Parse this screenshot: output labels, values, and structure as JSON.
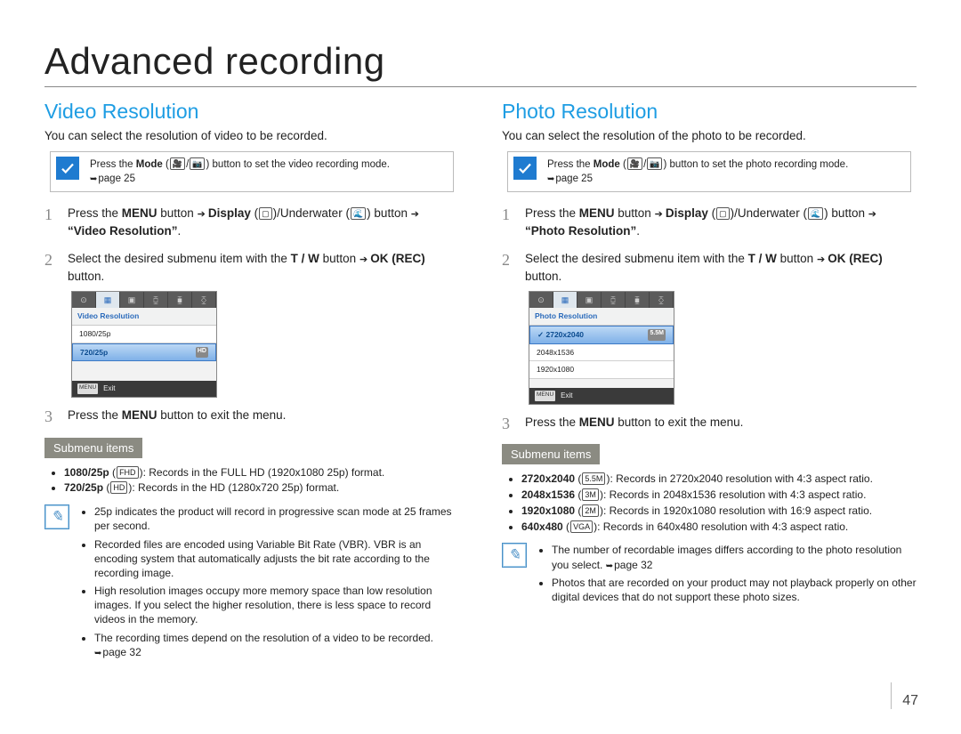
{
  "page": {
    "title": "Advanced recording",
    "number": "47"
  },
  "left": {
    "heading": "Video Resolution",
    "intro": "You can select the resolution of video to be recorded.",
    "tip_prefix": "Press the ",
    "tip_mode": "Mode",
    "tip_suffix": " button to set the video recording mode.",
    "tip_pageref": "page 25",
    "step1_a": "Press the ",
    "step1_menu": "MENU",
    "step1_b": " button ",
    "step1_display": "Display",
    "step1_under": "/Underwater",
    "step1_c": " button ",
    "step1_target": "“Video Resolution”",
    "step2_a": "Select the desired submenu item with the ",
    "step2_tw": "T / W",
    "step2_b": " button ",
    "step2_ok": "OK (REC)",
    "step2_c": " button.",
    "lcd_header": "Video Resolution",
    "lcd_rows": [
      {
        "label": "1080/25p",
        "sel": false
      },
      {
        "label": "720/25p",
        "sel": true,
        "badge": "HD"
      }
    ],
    "lcd_exit": "Exit",
    "step3_a": "Press the ",
    "step3_menu": "MENU",
    "step3_b": " button to exit the menu.",
    "submenu_label": "Submenu items",
    "submenu": [
      {
        "name": "1080/25p",
        "desc": ": Records in the FULL HD (1920x1080 25p) format."
      },
      {
        "name": "720/25p",
        "desc": ": Records in the HD (1280x720 25p) format."
      }
    ],
    "notes": [
      "25p indicates the product will record in progressive scan mode at 25 frames per second.",
      "Recorded files are encoded using Variable Bit Rate (VBR). VBR is an encoding system that automatically adjusts the bit rate according to the recording image.",
      "High resolution images occupy more memory space than low resolution images. If you select the higher resolution, there is less space to record videos in the memory.",
      "The recording times depend on the resolution of a video to be recorded. "
    ],
    "notes_pageref": "page 32"
  },
  "right": {
    "heading": "Photo Resolution",
    "intro": "You can select the resolution of the photo to be recorded.",
    "tip_prefix": "Press the ",
    "tip_mode": "Mode",
    "tip_suffix": " button to set the photo recording mode.",
    "tip_pageref": "page 25",
    "step1_a": "Press the ",
    "step1_menu": "MENU",
    "step1_b": " button ",
    "step1_display": "Display",
    "step1_under": "/Underwater",
    "step1_c": " button ",
    "step1_target": "“Photo Resolution”",
    "step2_a": "Select the desired submenu item with the ",
    "step2_tw": "T / W",
    "step2_b": " button ",
    "step2_ok": "OK (REC)",
    "step2_c": " button.",
    "lcd_header": "Photo Resolution",
    "lcd_rows": [
      {
        "label": "2720x2040",
        "sel": true,
        "badge": "5.5M"
      },
      {
        "label": "2048x1536",
        "sel": false
      },
      {
        "label": "1920x1080",
        "sel": false
      }
    ],
    "lcd_exit": "Exit",
    "step3_a": "Press the ",
    "step3_menu": "MENU",
    "step3_b": " button to exit the menu.",
    "submenu_label": "Submenu items",
    "submenu": [
      {
        "name": "2720x2040",
        "desc": ": Records in 2720x2040 resolution with 4:3 aspect ratio."
      },
      {
        "name": "2048x1536",
        "desc": ": Records in 2048x1536 resolution with 4:3 aspect ratio."
      },
      {
        "name": "1920x1080",
        "desc": ": Records in 1920x1080 resolution with 16:9 aspect ratio."
      },
      {
        "name": "640x480",
        "desc": ": Records in 640x480 resolution with 4:3 aspect ratio."
      }
    ],
    "notes": [
      "The number of recordable images differs according to the photo resolution you select. ",
      "Photos that are recorded on your product may not playback properly on other digital devices that do not support these photo sizes."
    ],
    "notes_pageref": "page 32"
  }
}
